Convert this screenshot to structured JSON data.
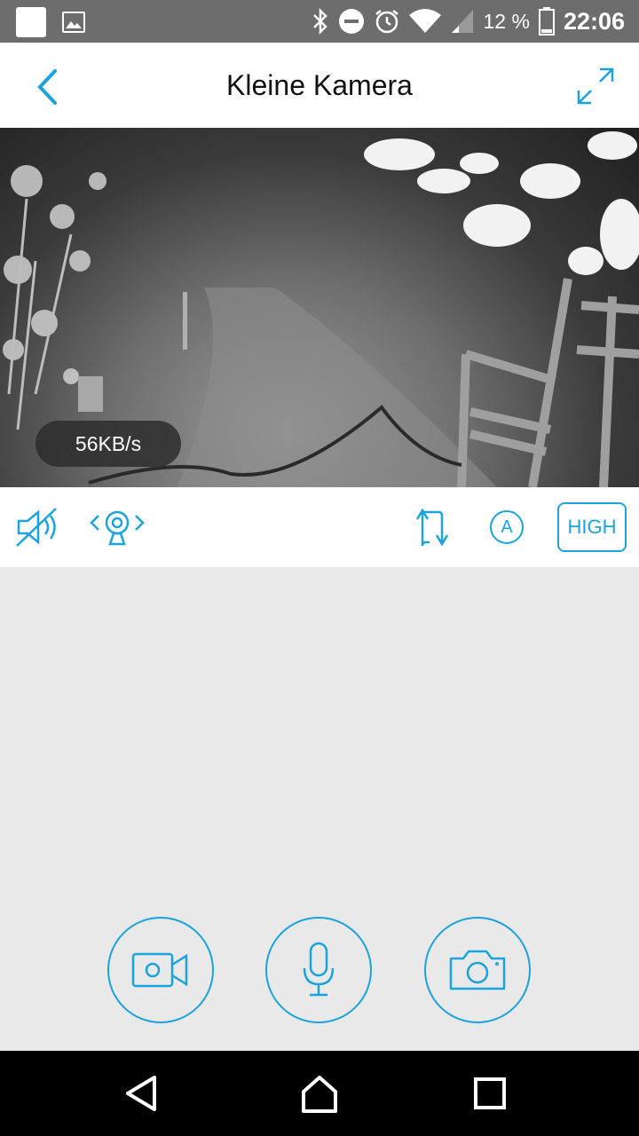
{
  "status_bar": {
    "battery_percent": "12 %",
    "time": "22:06",
    "icons": [
      "notification-square-icon",
      "image-icon",
      "bluetooth-icon",
      "do-not-disturb-icon",
      "alarm-icon",
      "wifi-icon",
      "signal-icon",
      "battery-icon"
    ]
  },
  "header": {
    "title": "Kleine Kamera",
    "back_icon": "chevron-left-icon",
    "expand_icon": "fullscreen-expand-icon"
  },
  "video": {
    "speed_label": "56KB/s"
  },
  "controls": {
    "mute_icon": "speaker-muted-icon",
    "ptz_icon": "camera-rotate-icon",
    "flip_icon": "flip-arrows-icon",
    "auto_label": "A",
    "quality_label": "HIGH"
  },
  "actions": {
    "record_icon": "video-camera-icon",
    "talk_icon": "microphone-icon",
    "snapshot_icon": "photo-camera-icon"
  },
  "colors": {
    "accent": "#1aa3dc",
    "status_bar": "#6d6d6d",
    "background": "#e9e9e9"
  }
}
